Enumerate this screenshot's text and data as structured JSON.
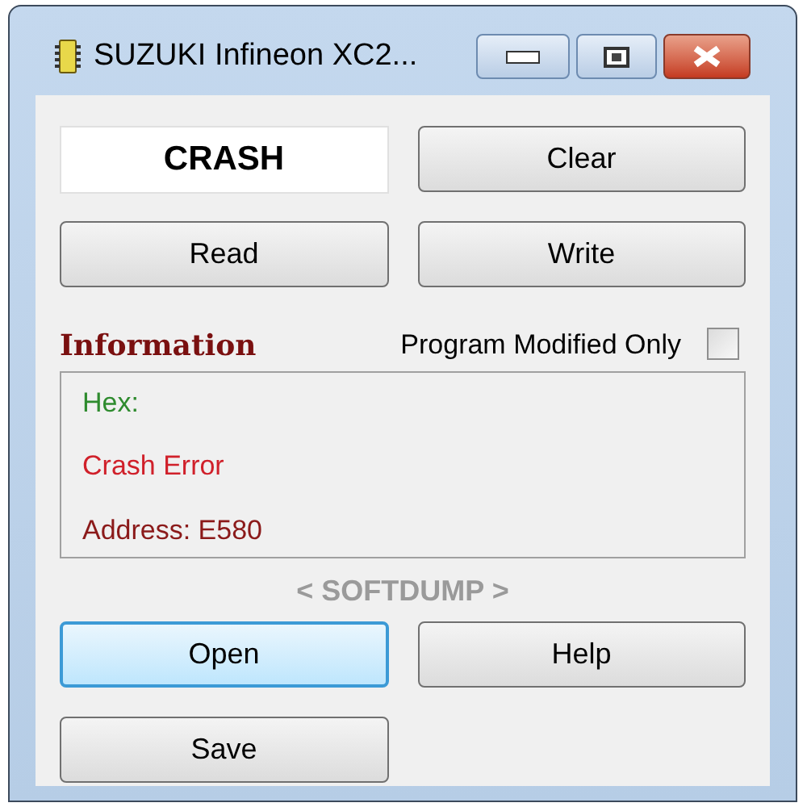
{
  "window": {
    "title": "SUZUKI Infineon XC2..."
  },
  "status_display": {
    "value": "CRASH"
  },
  "top_buttons": [
    {
      "label": "Clear",
      "focused": false
    },
    {
      "label": "Read",
      "focused": false
    },
    {
      "label": "Write",
      "focused": false
    }
  ],
  "information": {
    "label": "Information",
    "option": {
      "label": "Program Modified Only",
      "checked": false
    },
    "lines": [
      {
        "text": "Hex:",
        "color": "#2e8b2e"
      },
      {
        "text": "Crash Error",
        "color": "#d0202a"
      },
      {
        "text": "Address: E580",
        "color": "#8b1a1a"
      }
    ]
  },
  "brand": "< SOFTDUMP >",
  "bottom_buttons": [
    {
      "label": "Open",
      "focused": true
    },
    {
      "label": "Help",
      "focused": false
    },
    {
      "label": "Save",
      "focused": false
    }
  ]
}
